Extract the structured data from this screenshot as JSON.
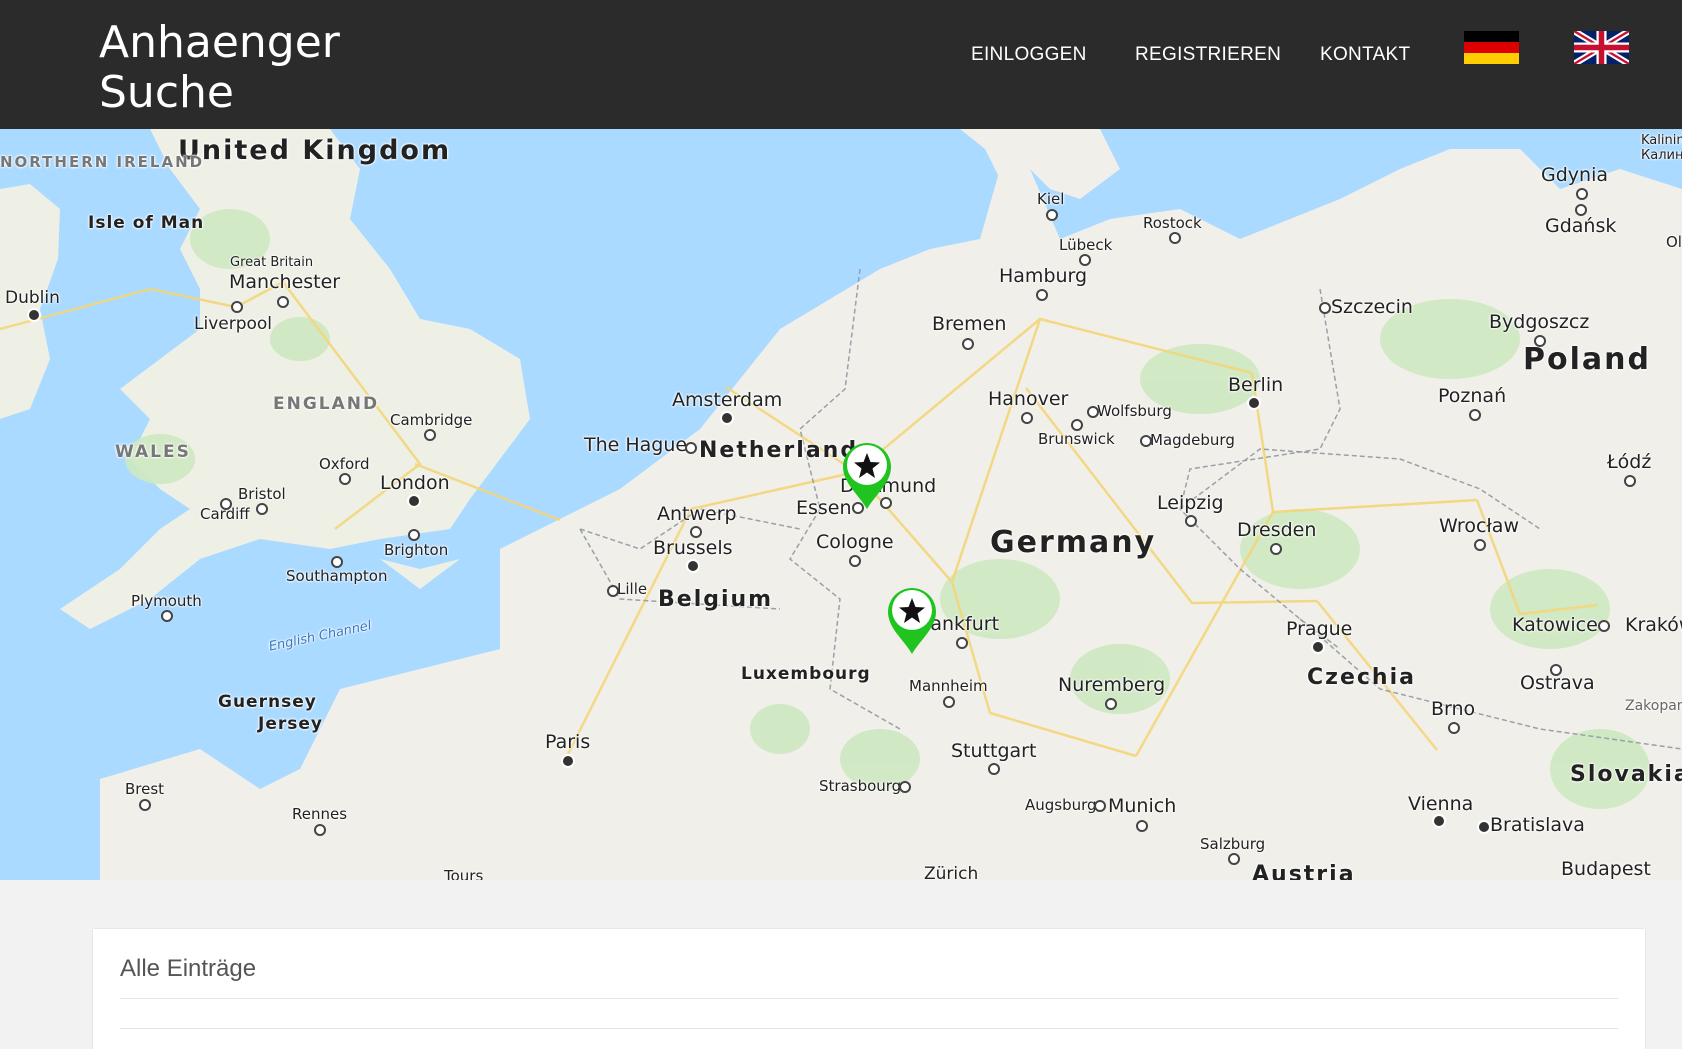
{
  "brand": {
    "line1": "Anhaenger",
    "line2": "Suche"
  },
  "nav": {
    "login": "EINLOGGEN",
    "register": "REGISTRIEREN",
    "contact": "KONTAKT"
  },
  "languages": [
    {
      "icon": "german-flag-icon"
    },
    {
      "icon": "uk-flag-icon"
    }
  ],
  "map": {
    "labels": {
      "united_kingdom": "United Kingdom",
      "isle_of_man": "Isle of Man",
      "northern_ireland": "NORTHERN IRELAND",
      "dublin": "Dublin",
      "great_britain": "Great Britain",
      "manchester": "Manchester",
      "liverpool": "Liverpool",
      "england": "ENGLAND",
      "wales": "WALES",
      "cambridge": "Cambridge",
      "oxford": "Oxford",
      "london": "London",
      "bristol": "Bristol",
      "cardiff": "Cardiff",
      "brighton": "Brighton",
      "southampton": "Southampton",
      "plymouth": "Plymouth",
      "english_channel": "English Channel",
      "guernsey": "Guernsey",
      "jersey": "Jersey",
      "brest": "Brest",
      "rennes": "Rennes",
      "paris": "Paris",
      "amsterdam": "Amsterdam",
      "the_hague": "The Hague",
      "netherlands": "Netherlands",
      "antwerp": "Antwerp",
      "brussels": "Brussels",
      "lille": "Lille",
      "belgium": "Belgium",
      "luxembourg": "Luxembourg",
      "essen": "Essen",
      "dortmund": "Dortmund",
      "cologne": "Cologne",
      "frankfurt": "Frankfurt",
      "mannheim": "Mannheim",
      "strasbourg": "Strasbourg",
      "stuttgart": "Stuttgart",
      "augsburg": "Augsburg",
      "munich": "Munich",
      "zurich": "Zürich",
      "salzburg": "Salzburg",
      "austria": "Austria",
      "kiel": "Kiel",
      "rostock": "Rostock",
      "lubeck": "Lübeck",
      "hamburg": "Hamburg",
      "bremen": "Bremen",
      "hanover": "Hanover",
      "wolfsburg": "Wolfsburg",
      "brunswick": "Brunswick",
      "magdeburg": "Magdeburg",
      "berlin": "Berlin",
      "leipzig": "Leipzig",
      "dresden": "Dresden",
      "germany": "Germany",
      "nuremberg": "Nuremberg",
      "prague": "Prague",
      "czechia": "Czechia",
      "brno": "Brno",
      "ostrava": "Ostrava",
      "katowice": "Katowice",
      "krakow": "Kraków",
      "zakopane": "Zakopane",
      "slovakia": "Slovakia",
      "vienna": "Vienna",
      "bratislava": "Bratislava",
      "budapest": "Budapest",
      "wroclaw": "Wrocław",
      "lodz": "Łódź",
      "poznan": "Poznań",
      "poland": "Poland",
      "bydgoszcz": "Bydgoszcz",
      "szczecin": "Szczecin",
      "gdansk": "Gdańsk",
      "gdynia": "Gdynia",
      "kaliningrad": "Kaliningrad Калининград",
      "olsztyn": "Olsztyn",
      "tours": "Tours"
    },
    "markers": [
      {
        "icon": "star-icon"
      },
      {
        "icon": "star-icon"
      }
    ]
  },
  "entries": {
    "title": "Alle Einträge"
  },
  "colors": {
    "navbar": "#2b2b2b",
    "water": "#aadaff",
    "land": "#f1efe9",
    "marker": "#1fc41f"
  }
}
